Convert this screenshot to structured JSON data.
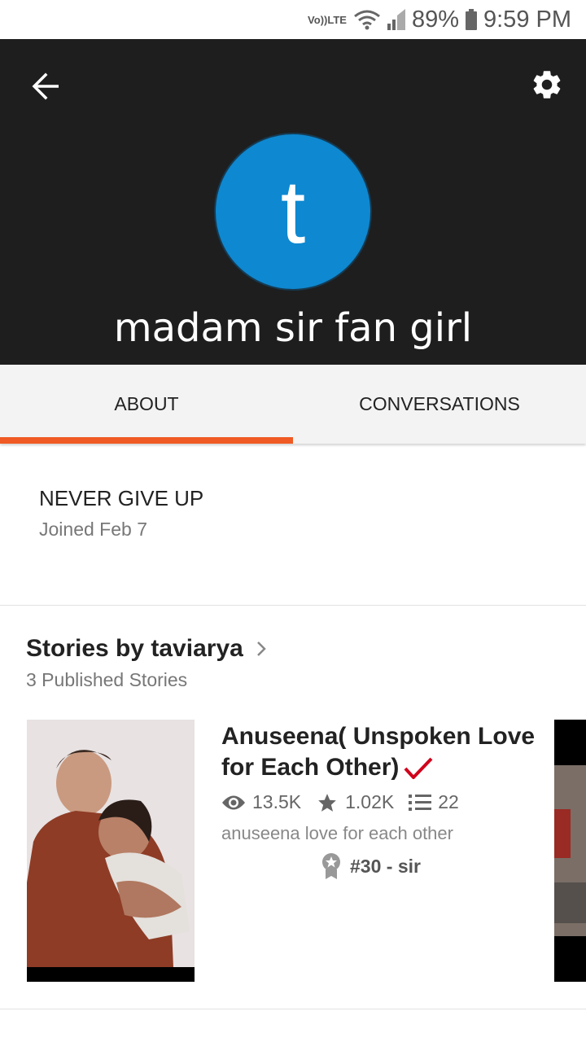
{
  "status_bar": {
    "volte_top": "Vo))",
    "volte_bottom": "LTE",
    "battery_percent": "89%",
    "time": "9:59 PM"
  },
  "header": {
    "avatar_letter": "t",
    "display_name": "madam sir fan girl",
    "avatar_color": "#0e88d0",
    "background_color": "#1e1e1e"
  },
  "tabs": [
    {
      "label": "ABOUT",
      "active": true
    },
    {
      "label": "CONVERSATIONS",
      "active": false
    }
  ],
  "about": {
    "tagline": "NEVER GIVE UP",
    "joined": "Joined Feb 7"
  },
  "stories": {
    "title": "Stories by taviarya",
    "subtitle": "3 Published Stories",
    "items": [
      {
        "title": "Anuseena(  Unspoken Love for Each Other)",
        "reads": "13.5K",
        "votes": "1.02K",
        "parts": "22",
        "description": "anuseena love for each other",
        "rank": "#30 - sir"
      }
    ]
  },
  "colors": {
    "accent": "#f05a24",
    "check": "#d0021b"
  }
}
